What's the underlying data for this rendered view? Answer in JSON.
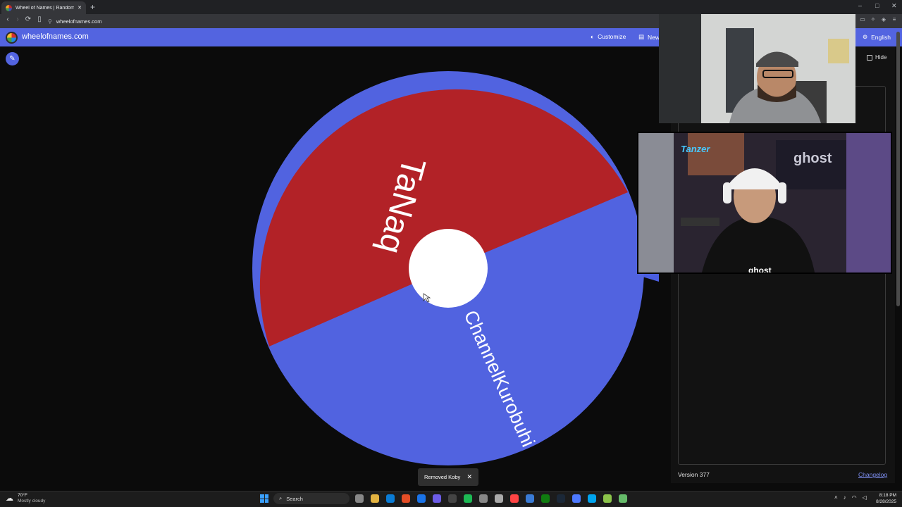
{
  "browser": {
    "tab_title": "Wheel of Names | Random n...",
    "new_tab_symbol": "+",
    "url": "wheelofnames.com",
    "window_controls": [
      "–",
      "□",
      "✕"
    ]
  },
  "header": {
    "site_name": "wheelofnames.com",
    "customize_label": "Customize",
    "new_label": "New",
    "language_label": "English"
  },
  "wheel": {
    "segments": [
      {
        "label": "TaNaq",
        "color": "#b22227"
      },
      {
        "label": "ChannelKurobuhi",
        "color": "#5163e0"
      }
    ],
    "center_color": "#ffffff"
  },
  "right_panel": {
    "hide_label": "Hide",
    "version": "Version 377",
    "changelog_label": "Changelog"
  },
  "cam2": {
    "neon_text": "Tanzer",
    "sign_text": "ghost",
    "shirt_text": "ghost"
  },
  "toast": {
    "message": "Removed Koby",
    "close_symbol": "✕"
  },
  "taskbar": {
    "weather_temp": "70°F",
    "weather_desc": "Mostly cloudy",
    "search_label": "Search",
    "time": "8:18 PM",
    "date": "8/28/2025",
    "icon_colors": [
      "#888888",
      "#e3b341",
      "#0a7cd6",
      "#e44d26",
      "#1a73e8",
      "#6c5ce7",
      "#444444",
      "#1db954",
      "#888888",
      "#aaaaaa",
      "#ff4444",
      "#3a7bd5",
      "#107c10",
      "#1b2838",
      "#4d79ff",
      "#00a4ef",
      "#8bc34a",
      "#66bb6a"
    ]
  }
}
